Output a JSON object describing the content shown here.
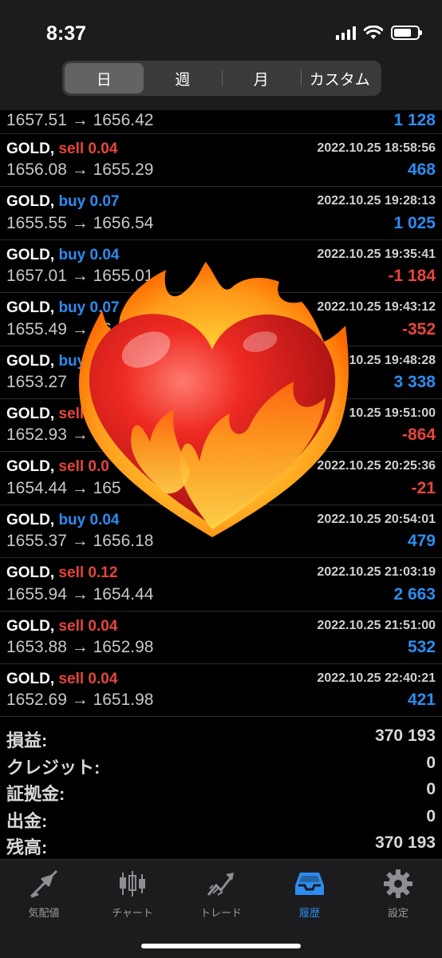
{
  "status": {
    "time": "8:37"
  },
  "segments": [
    {
      "label": "日",
      "active": true
    },
    {
      "label": "週",
      "active": false
    },
    {
      "label": "月",
      "active": false
    },
    {
      "label": "カスタム",
      "active": false
    }
  ],
  "partial_row": {
    "prices": "1657.51 → 1656.42",
    "profit": "1 128"
  },
  "trades": [
    {
      "symbol": "GOLD,",
      "side": "sell 0.04",
      "datetime": "2022.10.25 18:58:56",
      "prices": "1656.08 → 1655.29",
      "profit": "468"
    },
    {
      "symbol": "GOLD,",
      "side": "buy 0.07",
      "datetime": "2022.10.25 19:28:13",
      "prices": "1655.55 → 1656.54",
      "profit": "1 025"
    },
    {
      "symbol": "GOLD,",
      "side": "buy 0.04",
      "datetime": "2022.10.25 19:35:41",
      "prices": "1657.01 → 1655.01",
      "profit": "-1 184"
    },
    {
      "symbol": "GOLD,",
      "side": "buy 0.07",
      "datetime": "2022.10.25 19:43:12",
      "prices": "1655.49 → 16",
      "profit": "-352"
    },
    {
      "symbol": "GOLD,",
      "side": "buy",
      "datetime": "10.25 19:48:28",
      "prices": "1653.27",
      "profit": "3 338"
    },
    {
      "symbol": "GOLD,",
      "side": "sell",
      "datetime": "10.25 19:51:00",
      "prices": "1652.93 →",
      "profit": "-864"
    },
    {
      "symbol": "GOLD,",
      "side": "sell 0.0",
      "datetime": "2022.10.25 20:25:36",
      "prices": "1654.44 → 165",
      "profit": "-21"
    },
    {
      "symbol": "GOLD,",
      "side": "buy 0.04",
      "datetime": "2022.10.25 20:54:01",
      "prices": "1655.37 → 1656.18",
      "profit": "479"
    },
    {
      "symbol": "GOLD,",
      "side": "sell 0.12",
      "datetime": "2022.10.25 21:03:19",
      "prices": "1655.94 → 1654.44",
      "profit": "2 663"
    },
    {
      "symbol": "GOLD,",
      "side": "sell 0.04",
      "datetime": "2022.10.25 21:51:00",
      "prices": "1653.88 → 1652.98",
      "profit": "532"
    },
    {
      "symbol": "GOLD,",
      "side": "sell 0.04",
      "datetime": "2022.10.25 22:40:21",
      "prices": "1652.69 → 1651.98",
      "profit": "421"
    }
  ],
  "summary": [
    {
      "label": "損益:",
      "value": "370 193"
    },
    {
      "label": "クレジット:",
      "value": "0"
    },
    {
      "label": "証拠金:",
      "value": "0"
    },
    {
      "label": "出金:",
      "value": "0"
    },
    {
      "label": "残高:",
      "value": "370 193"
    }
  ],
  "tabs": [
    {
      "label": "気配値",
      "icon": "quotes-arrows-icon",
      "active": false
    },
    {
      "label": "チャート",
      "icon": "candlestick-chart-icon",
      "active": false
    },
    {
      "label": "トレード",
      "icon": "trade-trend-icon",
      "active": false
    },
    {
      "label": "履歴",
      "icon": "history-tray-icon",
      "active": true
    },
    {
      "label": "設定",
      "icon": "gear-icon",
      "active": false
    }
  ],
  "colors": {
    "sell": "#e8453c",
    "buy": "#2d8cf0",
    "accent": "#2d8cf0"
  },
  "overlay": {
    "icon": "heart-on-fire-emoji"
  }
}
